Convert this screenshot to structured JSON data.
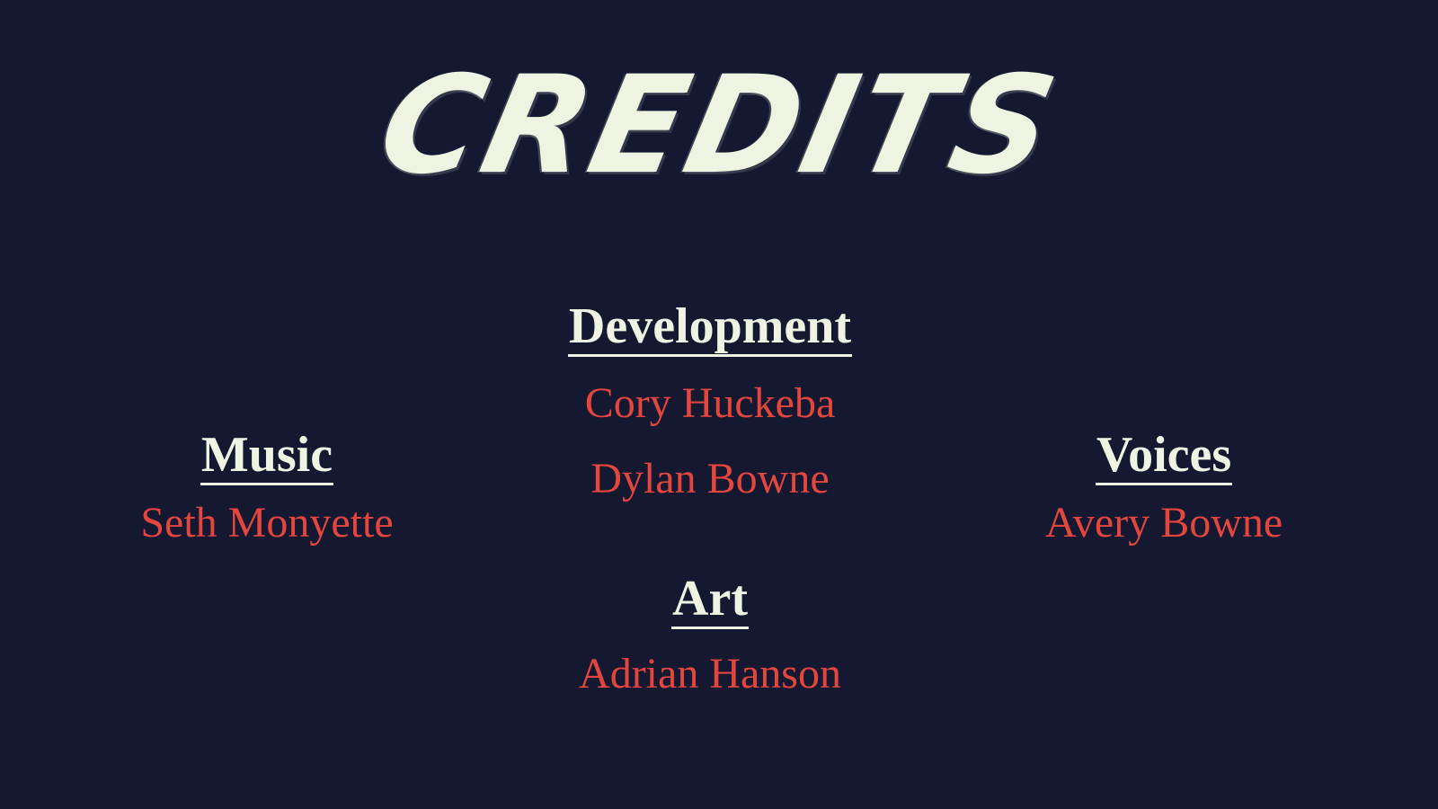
{
  "screen": {
    "title": "CREDITS"
  },
  "sections": {
    "development": {
      "heading": "Development",
      "names": [
        "Cory Huckeba",
        "Dylan Bowne"
      ]
    },
    "music": {
      "heading": "Music",
      "names": [
        "Seth Monyette"
      ]
    },
    "voices": {
      "heading": "Voices",
      "names": [
        "Avery Bowne"
      ]
    },
    "art": {
      "heading": "Art",
      "names": [
        "Adrian Hanson"
      ]
    }
  },
  "colors": {
    "background": "#141830",
    "heading": "#eef3e2",
    "name": "#e3463d"
  }
}
